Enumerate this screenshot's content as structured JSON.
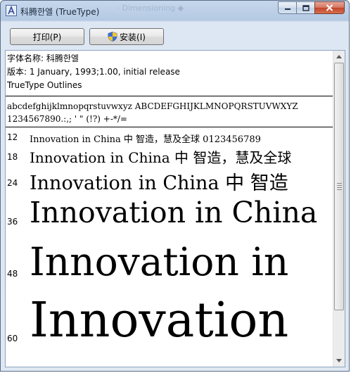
{
  "window": {
    "title": "科腾한엘 (TrueType)",
    "ghost_text": "   · Dimensioning  ◆"
  },
  "toolbar": {
    "print_label": "打印(P)",
    "install_label": "安装(I)"
  },
  "font_info": {
    "name_line": "字体名称: 科腾한엘",
    "version_line": "版本: 1 January, 1993;1.00, initial release",
    "type_line": "TrueType Outlines"
  },
  "charset": {
    "line1": "abcdefghijklmnopqrstuvwxyz ABCDEFGHIJKLMNOPQRSTUVWXYZ",
    "line2": "1234567890.:,; ' \" (!?) +-*/="
  },
  "samples": [
    {
      "size_label": "12",
      "text": "Innovation in China 中  智造，慧及全球 0123456789"
    },
    {
      "size_label": "18",
      "text": "Innovation in China 中  智造，慧及全球"
    },
    {
      "size_label": "24",
      "text": "Innovation in China 中  智造"
    },
    {
      "size_label": "36",
      "text": "Innovation in China"
    },
    {
      "size_label": "48",
      "text": "Innovation in"
    },
    {
      "size_label": "60",
      "text": "Innovation"
    }
  ],
  "colors": {
    "title_bar": "#c6d7ec",
    "close_button": "#c3452b",
    "content_bg": "#ffffff"
  },
  "icons": {
    "app": "font-viewer-icon",
    "install": "uac-shield-icon"
  }
}
